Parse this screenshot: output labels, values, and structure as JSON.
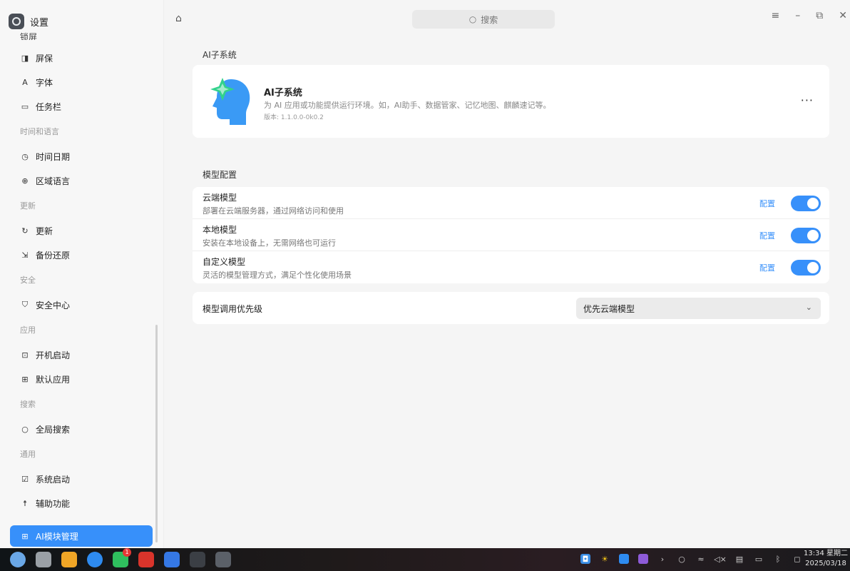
{
  "sidebar": {
    "app_title": "设置",
    "cut_item": "锁屏",
    "items": [
      {
        "type": "item",
        "icon": "screensaver-icon",
        "glyph": "◨",
        "label": "屏保"
      },
      {
        "type": "item",
        "icon": "font-icon",
        "glyph": "A",
        "label": "字体"
      },
      {
        "type": "item",
        "icon": "taskbar-icon",
        "glyph": "▭",
        "label": "任务栏"
      },
      {
        "type": "group",
        "label": "时间和语言"
      },
      {
        "type": "item",
        "icon": "clock-icon",
        "glyph": "◷",
        "label": "时间日期"
      },
      {
        "type": "item",
        "icon": "globe-icon",
        "glyph": "⊕",
        "label": "区域语言"
      },
      {
        "type": "group",
        "label": "更新"
      },
      {
        "type": "item",
        "icon": "refresh-icon",
        "glyph": "↻",
        "label": "更新"
      },
      {
        "type": "item",
        "icon": "backup-icon",
        "glyph": "⇲",
        "label": "备份还原"
      },
      {
        "type": "group",
        "label": "安全"
      },
      {
        "type": "item",
        "icon": "shield-icon",
        "glyph": "⛉",
        "label": "安全中心"
      },
      {
        "type": "group",
        "label": "应用"
      },
      {
        "type": "item",
        "icon": "autostart-icon",
        "glyph": "⊡",
        "label": "开机启动"
      },
      {
        "type": "item",
        "icon": "apps-grid-icon",
        "glyph": "⊞",
        "label": "默认应用"
      },
      {
        "type": "group",
        "label": "搜索"
      },
      {
        "type": "item",
        "icon": "search-icon",
        "glyph": "○",
        "label": "全局搜索"
      },
      {
        "type": "group",
        "label": "通用"
      },
      {
        "type": "item",
        "icon": "system-boot-icon",
        "glyph": "☑",
        "label": "系统启动"
      },
      {
        "type": "item",
        "icon": "accessibility-icon",
        "glyph": "☨",
        "label": "辅助功能"
      }
    ],
    "active_item": {
      "icon": "ai-module-icon",
      "glyph": "⊞",
      "label": "AI模块管理"
    }
  },
  "header": {
    "search_placeholder": "搜索"
  },
  "ai_section": {
    "title": "AI子系统",
    "name": "AI子系统",
    "description": "为 AI 应用或功能提供运行环境。如，AI助手、数据管家、记忆地图、麒麟速记等。",
    "version": "版本: 1.1.0.0-0k0.2",
    "more": "···"
  },
  "model_section": {
    "title": "模型配置",
    "rows": [
      {
        "title": "云端模型",
        "desc": "部署在云端服务器，通过网络访问和使用",
        "config": "配置",
        "enabled": true
      },
      {
        "title": "本地模型",
        "desc": "安装在本地设备上，无需网络也可运行",
        "config": "配置",
        "enabled": true
      },
      {
        "title": "自定义模型",
        "desc": "灵活的模型管理方式，满足个性化使用场景",
        "config": "配置",
        "enabled": true
      }
    ]
  },
  "priority": {
    "label": "模型调用优先级",
    "selected": "优先云端模型"
  },
  "taskbar": {
    "apps": [
      {
        "name": "start-menu-icon",
        "color": "#6aa7e6"
      },
      {
        "name": "multitask-view-icon",
        "color": "#9aa0a6"
      },
      {
        "name": "file-manager-icon",
        "color": "#f0a526"
      },
      {
        "name": "browser-icon",
        "color": "#2e8bf0"
      },
      {
        "name": "messaging-app-icon",
        "color": "#2fbf5e",
        "badge": "1"
      },
      {
        "name": "wps-office-icon",
        "color": "#d9342b"
      },
      {
        "name": "security-app-icon",
        "color": "#3578e5"
      },
      {
        "name": "terminal-icon",
        "color": "#3b3f45"
      },
      {
        "name": "settings-app-icon",
        "color": "#5b6068"
      }
    ],
    "time": "13:34 星期二",
    "date": "2025/03/18"
  }
}
